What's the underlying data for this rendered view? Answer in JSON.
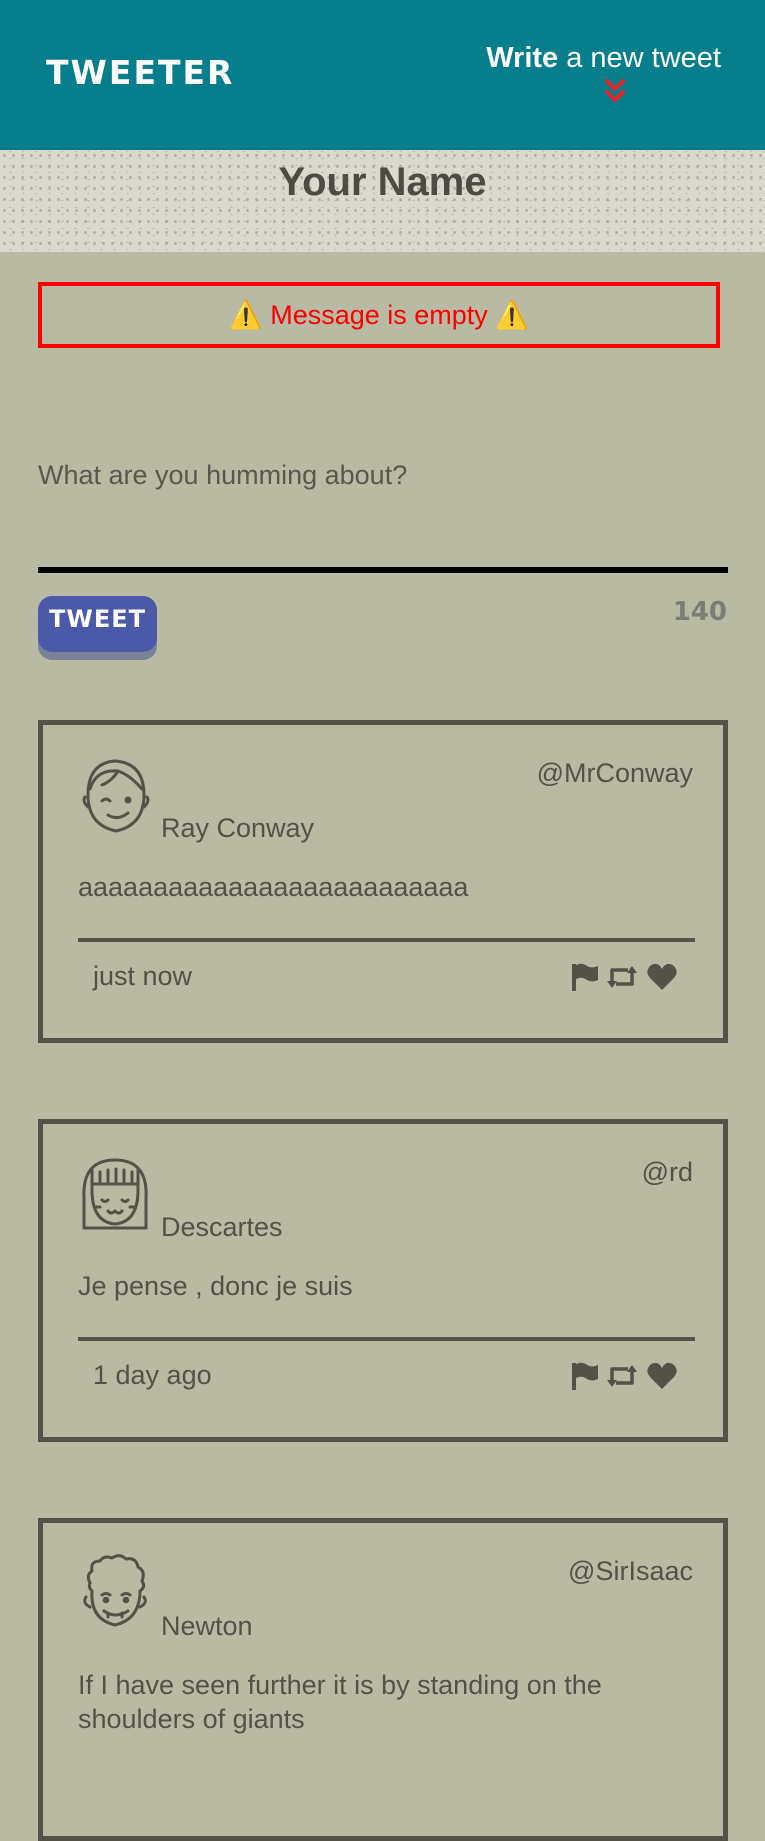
{
  "nav": {
    "brand": "TWEETER",
    "write_bold": "Write",
    "write_rest": "a new tweet",
    "chevron_icon": "double-chevron-down-icon",
    "chevron_color": "#e8242b"
  },
  "hero": {
    "name": "Your Name"
  },
  "compose": {
    "error": "⚠️ Message is empty ⚠️",
    "placeholder": "What are you humming about?",
    "button_label": "TWEET",
    "counter": "140"
  },
  "tweets": [
    {
      "name": "Ray Conway",
      "handle": "@MrConway",
      "text": "aaaaaaaaaaaaaaaaaaaaaaaaaa",
      "time": "just now",
      "avatar_icon": "boy-face-icon"
    },
    {
      "name": "Descartes",
      "handle": "@rd",
      "text": "Je pense , donc je suis",
      "time": "1 day ago",
      "avatar_icon": "girl-face-icon"
    },
    {
      "name": "Newton",
      "handle": "@SirIsaac",
      "text": "If I have seen further it is by standing on the shoulders of giants",
      "time": "",
      "avatar_icon": "curly-hair-face-icon"
    }
  ],
  "colors": {
    "nav_bg": "#077e8c",
    "page_bg": "#b9baa3",
    "error": "#ff0000",
    "button": "#4a5aa8",
    "text": "#545149"
  }
}
